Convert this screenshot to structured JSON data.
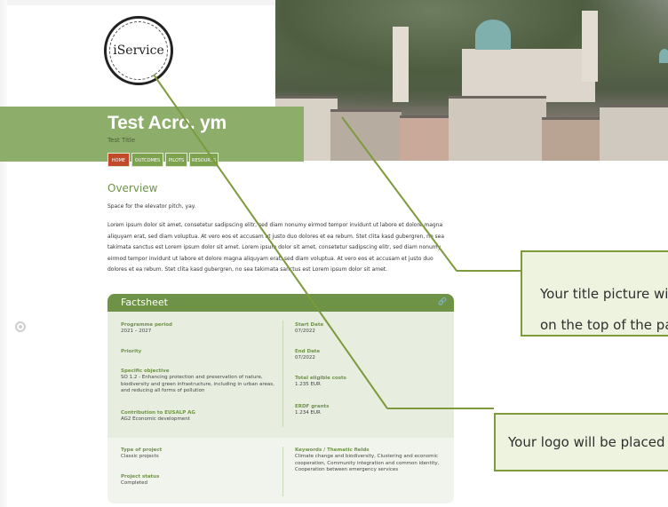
{
  "logo": {
    "text": "iService"
  },
  "project": {
    "acronym": "Test Acro. ym",
    "title": "Test Title"
  },
  "tabs": [
    "HOME",
    "OUTCOMES",
    "PILOTS",
    "RESOUR..S"
  ],
  "overview": {
    "heading": "Overview",
    "pitch": "Space for the elevator pitch, yay.",
    "body": "Lorem ipsum dolor sit amet, consetetur sadipscing elitr, sed diam nonumy eirmod tempor invidunt ut labore et dolore magna aliquyam erat, sed diam voluptua. At vero eos et accusam et justo duo dolores et ea rebum. Stet clita kasd gubergren, no sea takimata sanctus est Lorem ipsum dolor sit amet. Lorem ipsum dolor sit amet, consetetur sadipscing elitr, sed diam nonumy eirmod tempor invidunt ut labore et dolore magna aliquyam erat, sed diam voluptua. At vero eos et accusam et justo duo dolores et ea rebum. Stet clita kasd gubergren, no sea takimata sanctus est Lorem ipsum dolor sit amet."
  },
  "factsheet": {
    "title": "Factsheet",
    "link_icon": "link-icon",
    "programme_period_label": "Programme period",
    "programme_period": "2021 – 2027",
    "priority_label": "Priority",
    "specific_objective_label": "Specific objective",
    "specific_objective": "SO 1.2 - Enhancing protection and preservation of nature, biodiversity and green infrastructure, including in urban areas, and reducing all forms of pollution",
    "contribution_label": "Contribution to EUSALP AG",
    "contribution": "AG2 Economic development",
    "start_date_label": "Start Date",
    "start_date": "07/2022",
    "end_date_label": "End Date",
    "end_date": "07/2022",
    "total_costs_label": "Total eligible costs",
    "total_costs": "1.235 EUR",
    "erdf_label": "ERDF grants",
    "erdf": "1.234 EUR",
    "type_label": "Type of project",
    "type": "Classic projects",
    "status_label": "Project status",
    "status": "Completed",
    "keywords_label": "Keywords / Thematic fields",
    "keywords": "Climate change and biodiversity, Clustering and economic cooperation, Community integration and common identity, Cooperation between emergency services"
  },
  "callouts": {
    "title_picture": "Your title picture will be placed\non the top of the page",
    "logo": "Your logo will be placed here"
  },
  "colors": {
    "accent_green": "#6e9347",
    "band_green": "#8dad6a",
    "home_tab": "#c24a2a",
    "callout_border": "#7d9a3c",
    "callout_bg": "#edf3de"
  }
}
